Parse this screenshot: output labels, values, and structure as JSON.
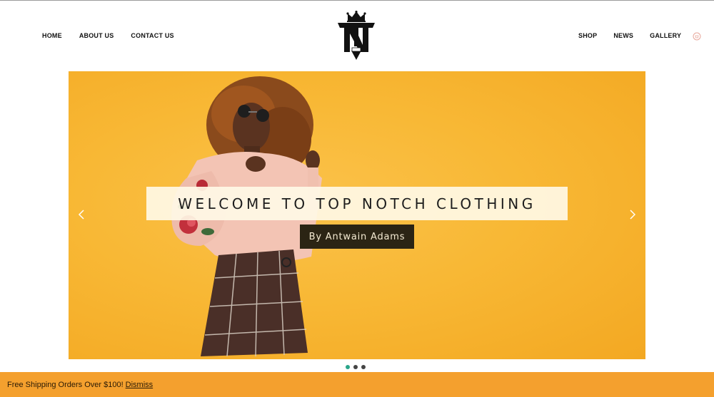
{
  "nav": {
    "left": [
      "HOME",
      "ABOUT US",
      "CONTACT US"
    ],
    "right": [
      "SHOP",
      "NEWS",
      "GALLERY"
    ]
  },
  "hero": {
    "title": "WELCOME TO TOP NOTCH CLOTHING",
    "subtitle": "By Antwain Adams",
    "slide_count": 3,
    "active_slide": 1
  },
  "icons": {
    "logo": "top-notch-logo",
    "cart": "cart-icon",
    "prev": "chevron-left-icon",
    "next": "chevron-right-icon"
  },
  "banner": {
    "text": "Free Shipping Orders Over $100!",
    "dismiss": "Dismiss"
  },
  "colors": {
    "accent_orange": "#f4a02e",
    "hero_yellow": "#f8b835",
    "dot_active": "#2aa58a",
    "dot_inactive": "#444444",
    "subtitle_bg": "#2b2414"
  }
}
